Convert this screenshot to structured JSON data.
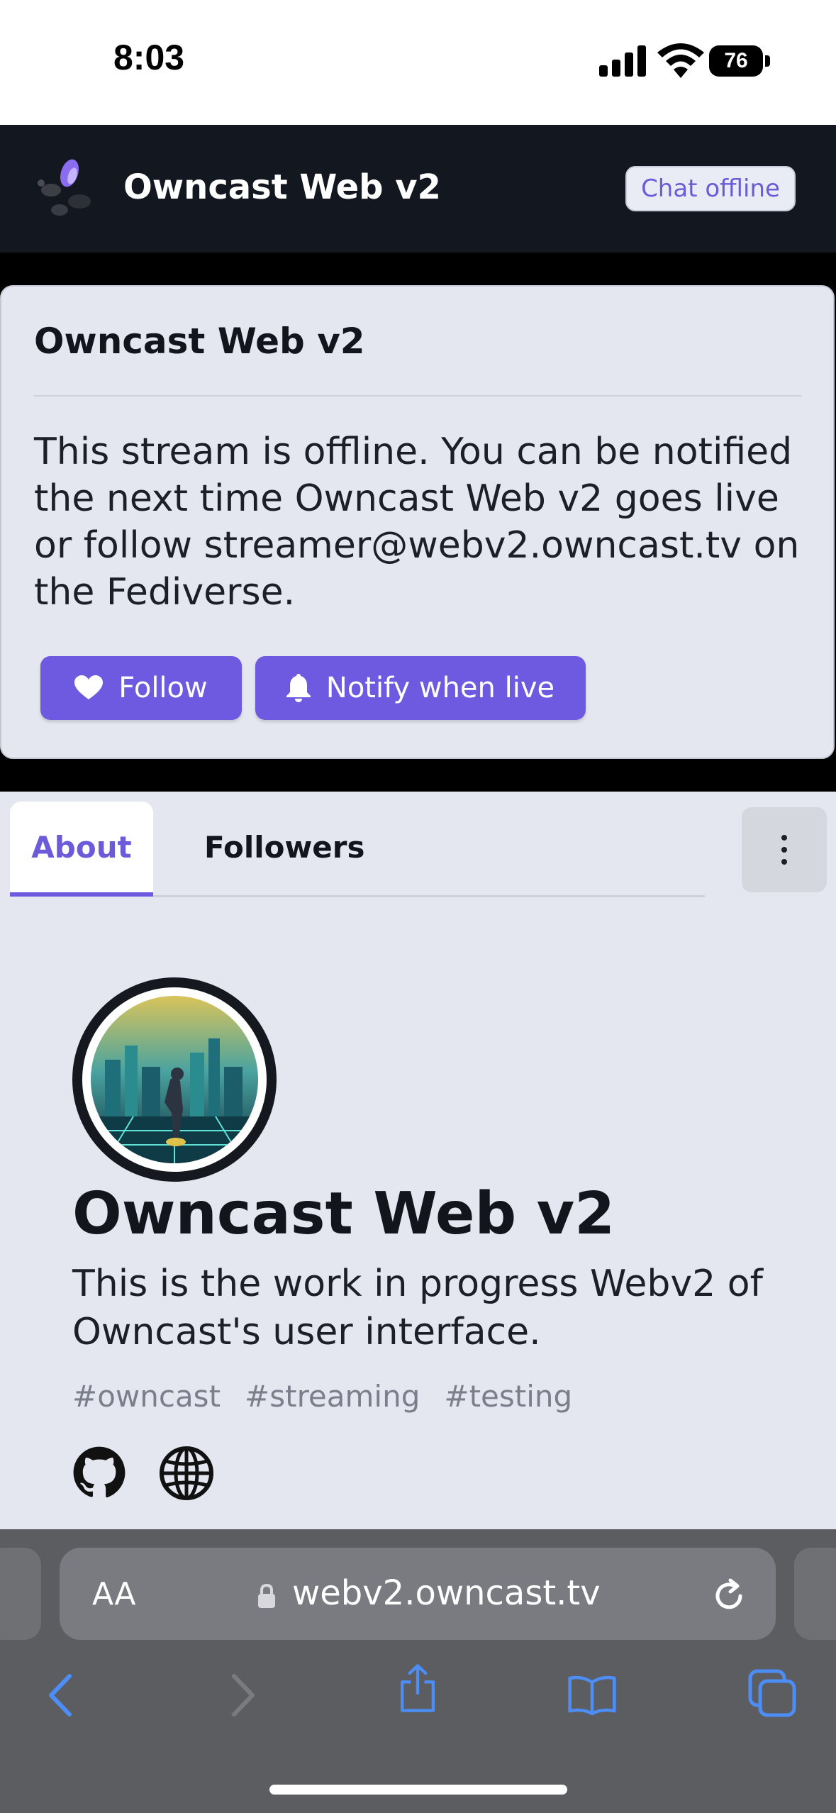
{
  "status_bar": {
    "time": "8:03",
    "battery": "76"
  },
  "header": {
    "title": "Owncast Web v2",
    "chat_status": "Chat offline"
  },
  "offline_card": {
    "title": "Owncast Web v2",
    "message": "This stream is offline. You can be notified the next time Owncast Web v2 goes live or follow streamer@webv2.owncast.tv on the Fediverse.",
    "follow_label": "Follow",
    "notify_label": "Notify when live"
  },
  "tabs": [
    {
      "label": "About",
      "active": true
    },
    {
      "label": "Followers",
      "active": false
    }
  ],
  "profile": {
    "name": "Owncast Web v2",
    "description": "This is the work in progress Webv2 of Owncast's user interface.",
    "tags": [
      "#owncast",
      "#streaming",
      "#testing"
    ],
    "social_icons": [
      "github-icon",
      "globe-icon"
    ]
  },
  "browser": {
    "text_size_label": "AA",
    "url": "webv2.owncast.tv"
  },
  "colors": {
    "accent": "#6e5ae0",
    "header_bg": "#13171f",
    "content_bg": "#e4e7f0"
  }
}
